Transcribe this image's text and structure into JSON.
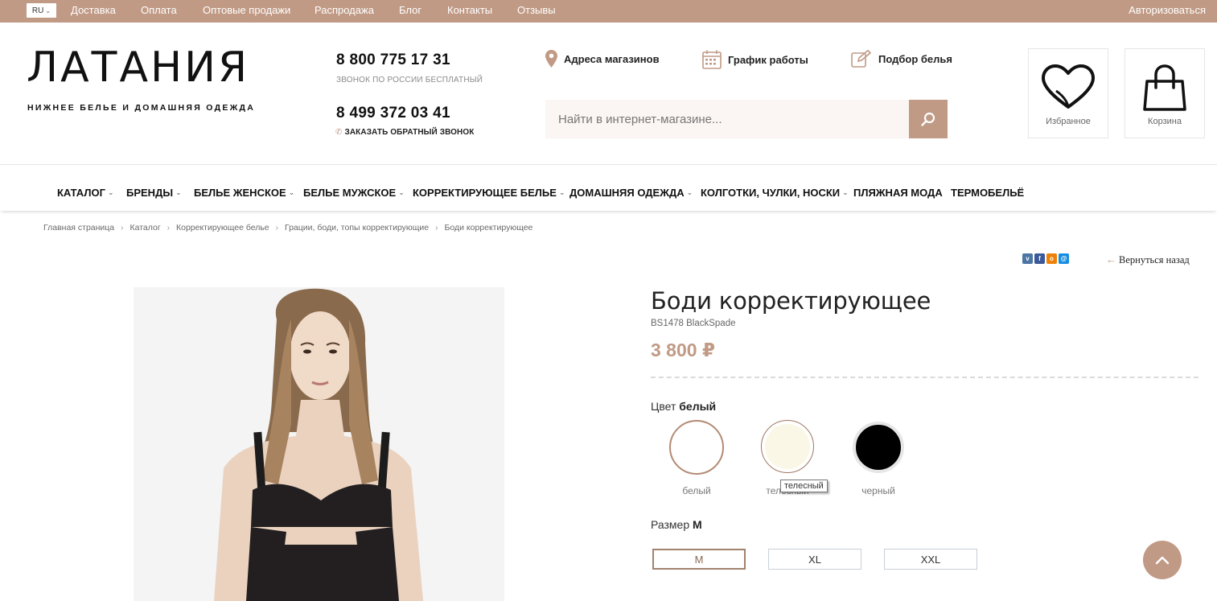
{
  "topbar": {
    "lang": "RU",
    "links": [
      "Доставка",
      "Оплата",
      "Оптовые продажи",
      "Распродажа",
      "Блог",
      "Контакты",
      "Отзывы"
    ],
    "login": "Авторизоваться"
  },
  "logo": {
    "title": "ЛАТАНИЯ",
    "subtitle": "НИЖНЕЕ БЕЛЬЕ И ДОМАШНЯЯ ОДЕЖДА"
  },
  "contacts": {
    "phone1": "8 800 775 17 31",
    "phone1_note": "ЗВОНОК ПО РОССИИ БЕСПЛАТНЫЙ",
    "phone2": "8 499 372 03 41",
    "callback": "ЗАКАЗАТЬ ОБРАТНЫЙ ЗВОНОК"
  },
  "header_links": {
    "stores": "Адреса магазинов",
    "schedule": "График работы",
    "fitting": "Подбор белья"
  },
  "search": {
    "placeholder": "Найти в интернет-магазине..."
  },
  "header_boxes": {
    "favorites": "Избранное",
    "cart": "Корзина"
  },
  "nav": {
    "catalog": "КАТАЛОГ",
    "brands": "БРЕНДЫ",
    "women": "БЕЛЬЕ ЖЕНСКОЕ",
    "men": "БЕЛЬЕ МУЖСКОЕ",
    "shaping": "КОРРЕКТИРУЮЩЕЕ БЕЛЬЕ",
    "home": "ДОМАШНЯЯ ОДЕЖДА",
    "tights": "КОЛГОТКИ, ЧУЛКИ, НОСКИ",
    "beach": "ПЛЯЖНАЯ МОДА",
    "thermo": "ТЕРМОБЕЛЬЁ"
  },
  "breadcrumbs": [
    "Главная страница",
    "Каталог",
    "Корректирующее белье",
    "Грации, боди, топы корректирующие",
    "Боди корректирующее"
  ],
  "back_label": "Вернуться назад",
  "product": {
    "title": "Боди корректирующее",
    "sku": "BS1478 BlackSpade",
    "price": "3 800 ₽",
    "color_label": "Цвет",
    "color_selected": "белый",
    "colors": [
      {
        "name": "белый",
        "hex": "#ffffff"
      },
      {
        "name": "телесный",
        "hex": "#fbf7e6"
      },
      {
        "name": "черный",
        "hex": "#000000"
      }
    ],
    "tooltip": "телесный",
    "size_label": "Размер",
    "size_selected": "M",
    "sizes": [
      "M",
      "XL",
      "XXL"
    ]
  },
  "colors": {
    "accent": "#c09a85",
    "topbar": "#c09a85"
  }
}
